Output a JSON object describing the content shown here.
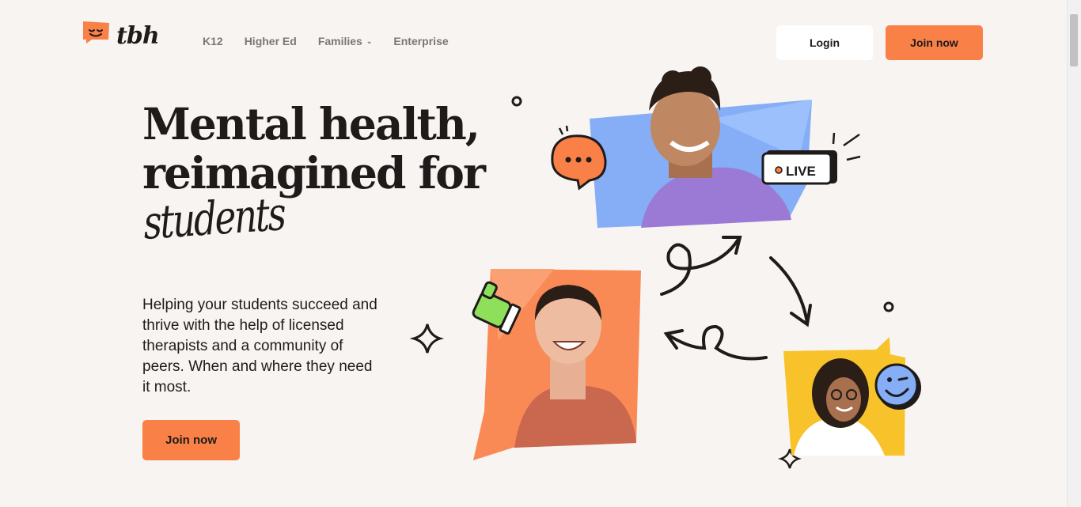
{
  "brand": {
    "name": "tbh",
    "accent": "#f98047"
  },
  "nav": {
    "items": [
      {
        "label": "K12",
        "dropdown": false
      },
      {
        "label": "Higher Ed",
        "dropdown": false
      },
      {
        "label": "Families",
        "dropdown": true
      },
      {
        "label": "Enterprise",
        "dropdown": false
      }
    ]
  },
  "header": {
    "login_label": "Login",
    "join_label": "Join now"
  },
  "hero": {
    "headline_line1": "Mental health,",
    "headline_line2": "reimagined for",
    "headline_script": "students",
    "subtext": "Helping your students succeed and thrive with the help of licensed therapists and a community of peers. When and where they need it most.",
    "cta_label": "Join now"
  },
  "illustration": {
    "badge_label": "LIVE",
    "icons": [
      "chat-bubble-icon",
      "live-badge-icon",
      "thumbs-up-icon",
      "wink-emoji-icon",
      "sparkle-icon",
      "curly-arrow-icon"
    ],
    "colors": {
      "blue_panel": "#85aef7",
      "orange_panel": "#f98a56",
      "yellow_panel": "#f8c22b",
      "green": "#8ee05a"
    }
  }
}
